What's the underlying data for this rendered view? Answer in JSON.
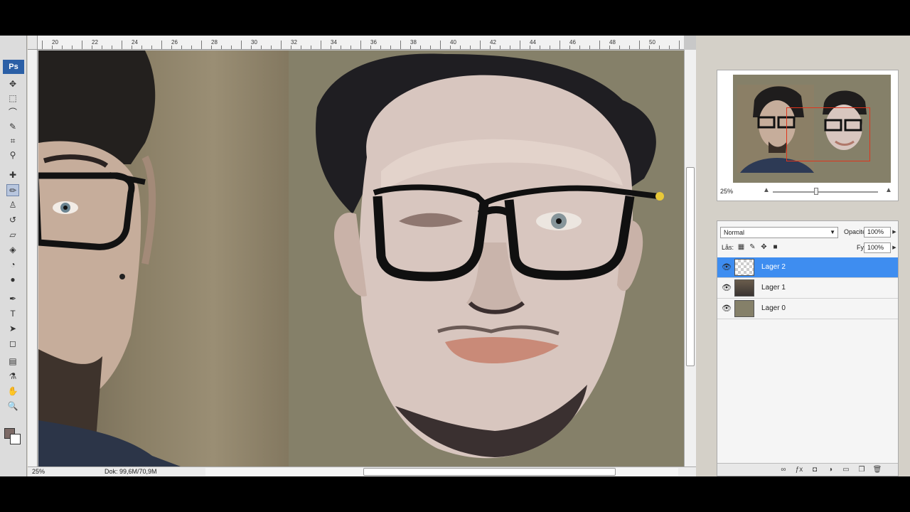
{
  "toolbox": {
    "logo": "Ps",
    "tools": [
      {
        "name": "move-tool-icon",
        "glyph": "✥"
      },
      {
        "name": "marquee-tool-icon",
        "glyph": "⬚"
      },
      {
        "name": "lasso-tool-icon",
        "glyph": "⌒"
      },
      {
        "name": "quick-select-tool-icon",
        "glyph": "✎"
      },
      {
        "name": "crop-tool-icon",
        "glyph": "⌗"
      },
      {
        "name": "eyedropper-tool-icon",
        "glyph": "⚲"
      },
      {
        "name": "healing-brush-tool-icon",
        "glyph": "✚"
      },
      {
        "name": "brush-tool-icon",
        "glyph": "✏"
      },
      {
        "name": "clone-stamp-tool-icon",
        "glyph": "♙"
      },
      {
        "name": "history-brush-tool-icon",
        "glyph": "↺"
      },
      {
        "name": "eraser-tool-icon",
        "glyph": "▱"
      },
      {
        "name": "paint-bucket-tool-icon",
        "glyph": "◈"
      },
      {
        "name": "blur-tool-icon",
        "glyph": "◔"
      },
      {
        "name": "dodge-tool-icon",
        "glyph": "●"
      },
      {
        "name": "pen-tool-icon",
        "glyph": "✒"
      },
      {
        "name": "type-tool-icon",
        "glyph": "T"
      },
      {
        "name": "path-select-tool-icon",
        "glyph": "➤"
      },
      {
        "name": "shape-tool-icon",
        "glyph": "◻"
      },
      {
        "name": "notes-tool-icon",
        "glyph": "▤"
      },
      {
        "name": "eyedropper2-tool-icon",
        "glyph": "⚗"
      },
      {
        "name": "hand-tool-icon",
        "glyph": "✋"
      },
      {
        "name": "zoom-tool-icon",
        "glyph": "🔍"
      }
    ]
  },
  "document": {
    "ruler_labels": [
      "20",
      "22",
      "24",
      "26",
      "28",
      "30",
      "32",
      "34",
      "36",
      "38",
      "40",
      "42",
      "44",
      "46",
      "48",
      "50"
    ],
    "zoom": "25%",
    "doc_size": "Dok: 99,6M/70,9M"
  },
  "navigator": {
    "zoom": "25%"
  },
  "layers": {
    "blend_mode": "Normal",
    "opacity_label": "Opacitet:",
    "opacity_value": "100%",
    "lock_label": "Lås:",
    "fill_label": "Fyll:",
    "fill_value": "100%",
    "items": [
      {
        "name": "Lager 2",
        "thumb": "checker",
        "selected": true
      },
      {
        "name": "Lager 1",
        "thumb": "photo",
        "selected": false
      },
      {
        "name": "Lager 0",
        "thumb": "solid",
        "selected": false
      }
    ]
  },
  "colors": {
    "canvas_background": "#858069",
    "selection_highlight": "#3e8df0",
    "navigator_view_box": "#e0341c",
    "foreground_color": "#7c6a66",
    "background_color": "#ffffff"
  }
}
